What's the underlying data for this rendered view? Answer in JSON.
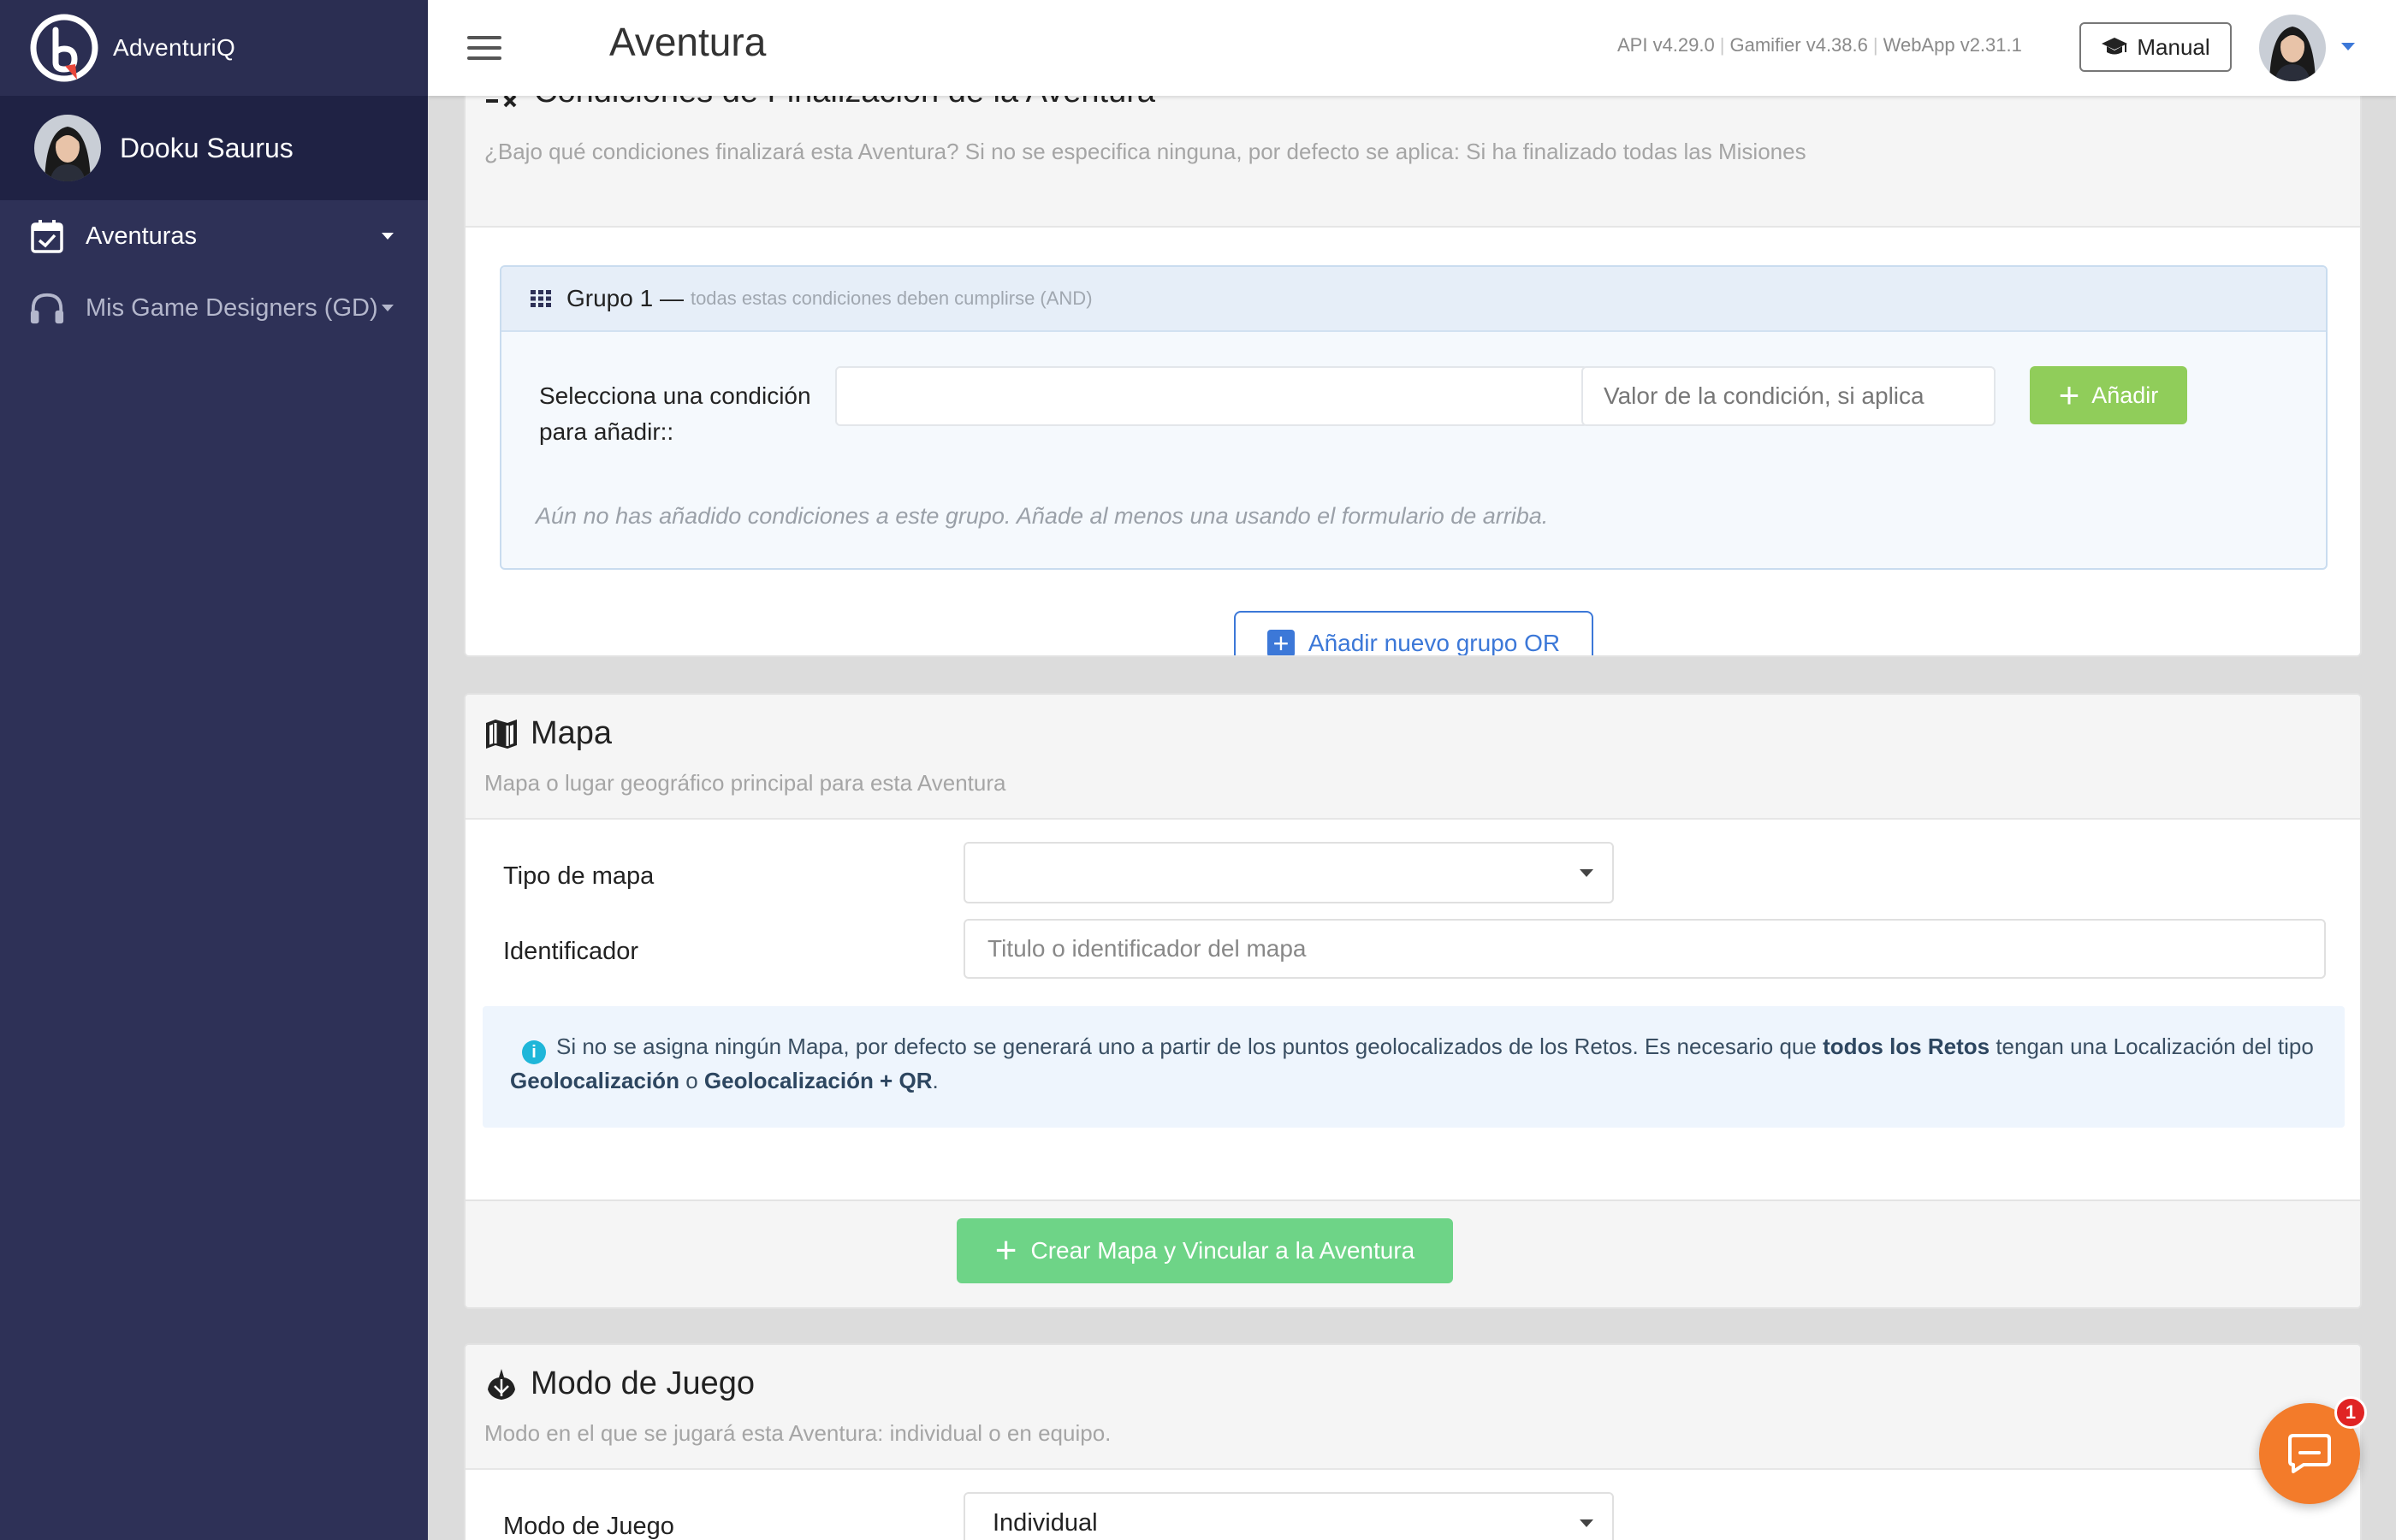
{
  "app": {
    "brand_name": "AdventuriQ"
  },
  "sidebar": {
    "user_name": "Dooku Saurus",
    "items": [
      {
        "label": "Aventuras",
        "icon": "calendar-check-icon"
      },
      {
        "label": "Mis Game Designers (GD)",
        "icon": "headphones-icon"
      }
    ]
  },
  "header": {
    "title": "Aventura",
    "versions": [
      "API v4.29.0",
      "Gamifier v4.38.6",
      "WebApp v2.31.1"
    ],
    "manual_label": "Manual",
    "accent_color": "#3c78d8"
  },
  "end_conditions": {
    "title": "Condiciones de Finalización de la Aventura",
    "subtitle": "¿Bajo qué condiciones finalizará esta Aventura? Si no se especifica ninguna, por defecto se aplica: Si ha finalizado todas las Misiones",
    "group_title": "Grupo 1",
    "group_dash": "—",
    "group_note": "todas estas condiciones deben cumplirse (AND)",
    "select_label": "Selecciona una condición para añadir::",
    "select_value": "",
    "value_placeholder": "Valor de la condición, si aplica",
    "add_label": "Añadir",
    "empty_note": "Aún no has añadido condiciones a este grupo. Añade al menos una usando el formulario de arriba.",
    "or_group_label": "Añadir nuevo grupo OR"
  },
  "map": {
    "title": "Mapa",
    "subtitle": "Mapa o lugar geográfico principal para esta Aventura",
    "type_label": "Tipo de mapa",
    "type_value": "",
    "id_label": "Identificador",
    "id_placeholder": "Titulo o identificador del mapa",
    "info_1": "Si no se asigna ningún Mapa, por defecto se generará uno a partir de los puntos geolocalizados de los Retos. Es necesario que",
    "info_bold_1": "todos los Retos",
    "info_2": "tengan una Localización del tipo",
    "info_bold_2": "Geolocalización",
    "info_3": "o",
    "info_bold_3": "Geolocalización + QR",
    "info_4": ".",
    "create_label": "Crear Mapa y Vincular a la Aventura"
  },
  "game_mode": {
    "title": "Modo de Juego",
    "subtitle": "Modo en el que se jugará esta Aventura: individual o en equipo.",
    "label": "Modo de Juego",
    "value": "Individual"
  },
  "chat": {
    "badge_count": "1"
  }
}
